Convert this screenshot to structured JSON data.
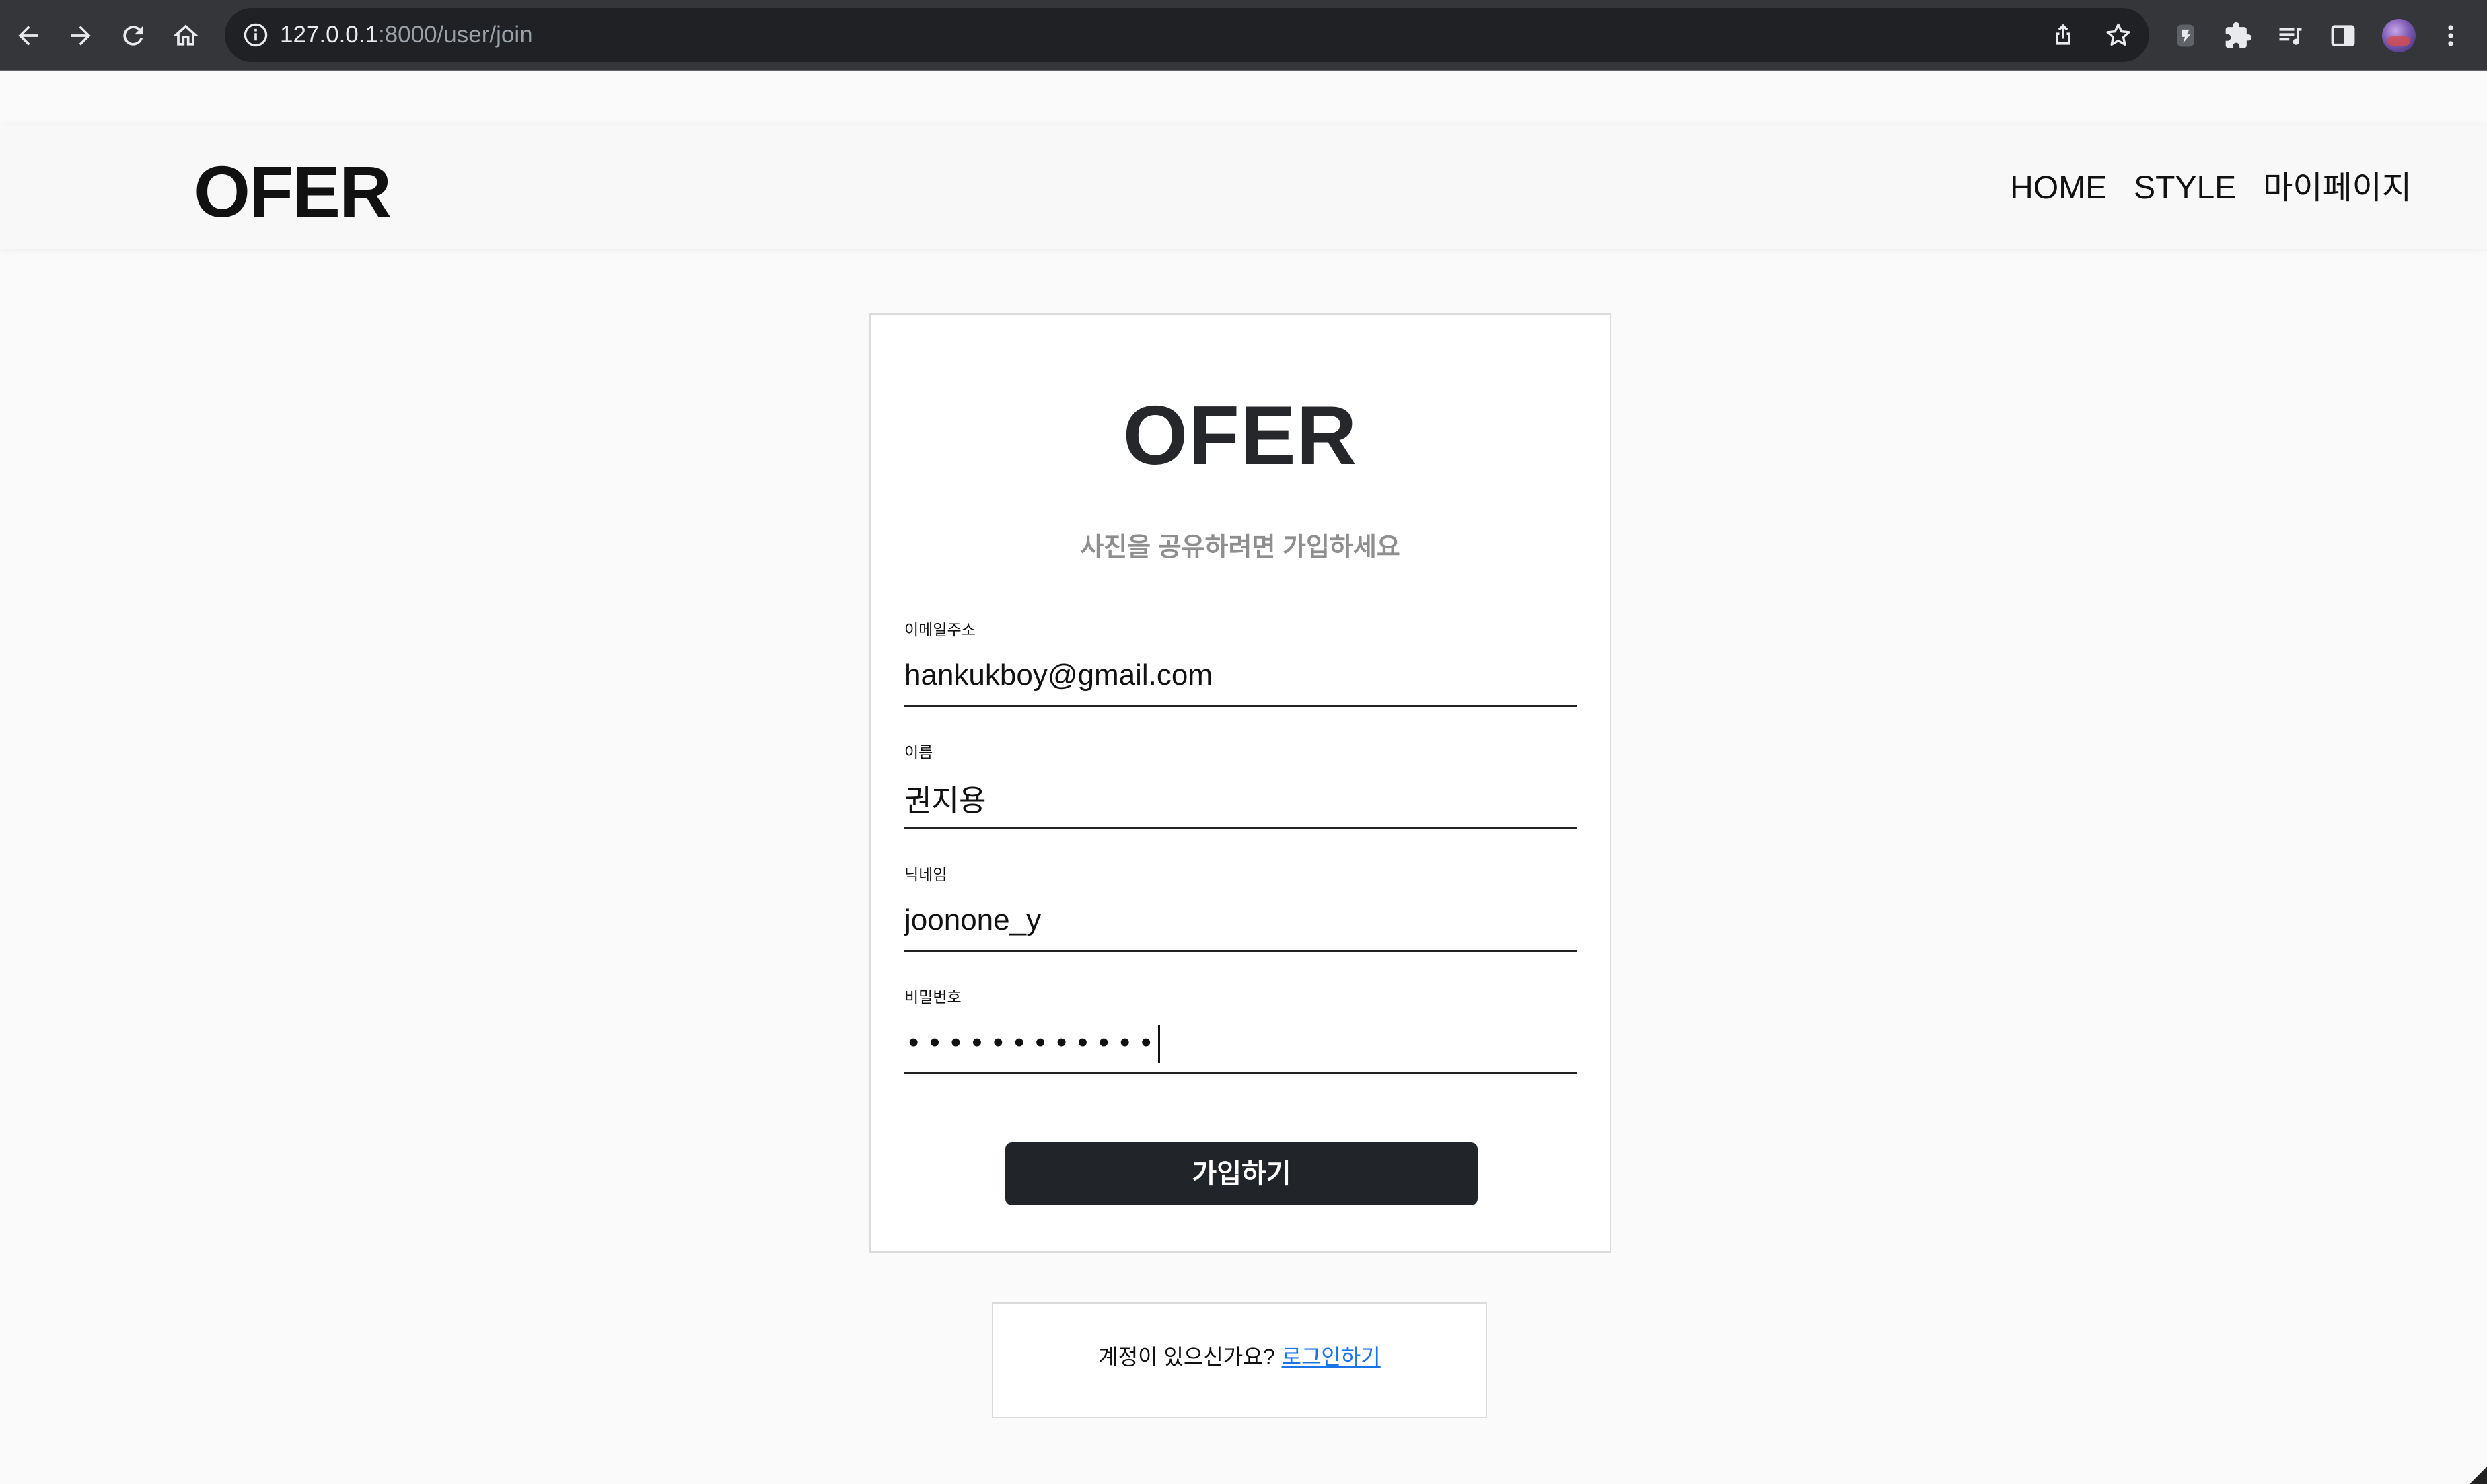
{
  "browser": {
    "url_host": "127.0.0.1",
    "url_rest": ":8000/user/join",
    "icons": {
      "back": "arrow-left-icon",
      "forward": "arrow-right-icon",
      "reload": "reload-icon",
      "home": "home-icon",
      "info": "info-icon",
      "share": "share-icon",
      "bookmark": "star-icon",
      "extension1": "extension-badge-icon",
      "extensions": "puzzle-icon",
      "reading_list": "reading-list-icon",
      "side_panel": "side-panel-icon",
      "menu": "kebab-menu-icon"
    }
  },
  "header": {
    "logo": "OFER",
    "nav": {
      "home": "HOME",
      "style": "STYLE",
      "mypage": "마이페이지"
    }
  },
  "join_form": {
    "logo": "OFER",
    "subtitle": "사진을 공유하려면 가입하세요",
    "email": {
      "label": "이메일주소",
      "value": "hankukboy@gmail.com"
    },
    "name": {
      "label": "이름",
      "value": "권지용"
    },
    "nickname": {
      "label": "닉네임",
      "value": "joonone_y"
    },
    "password": {
      "label": "비밀번호",
      "masked": "••••••••••••"
    },
    "submit_label": "가입하기"
  },
  "login_prompt": {
    "text": "계정이 있으신가요?",
    "link_label": "로그인하기"
  },
  "colors": {
    "page_bg": "#fafafa",
    "button_bg": "#212428",
    "link": "#1a73e8",
    "subtitle": "#8e8e8e"
  }
}
